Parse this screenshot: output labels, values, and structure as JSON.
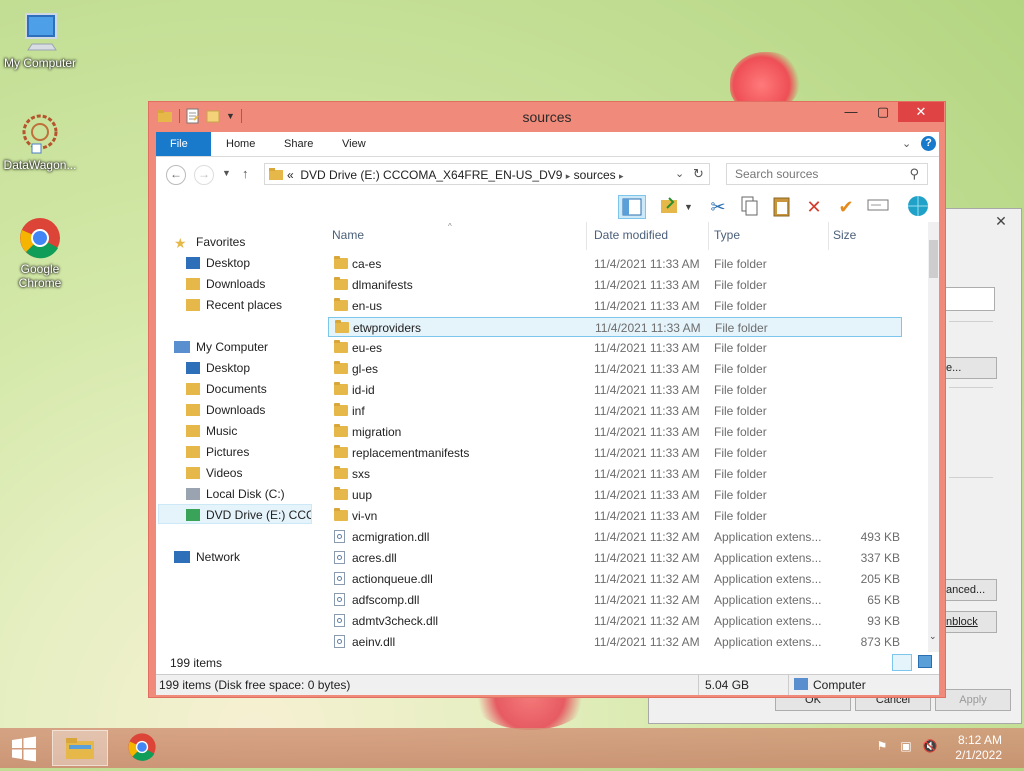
{
  "desktop": {
    "icons": [
      {
        "label": "My Computer"
      },
      {
        "label": "DataWagon..."
      },
      {
        "label": "Google Chrome"
      }
    ]
  },
  "dialog": {
    "btn_change": "e...",
    "btn_advanced": "anced...",
    "btn_unblock": "nblock",
    "btn_ok": "OK",
    "btn_cancel": "Cancel",
    "btn_apply": "Apply"
  },
  "explorer": {
    "title": "sources",
    "tabs": [
      "File",
      "Home",
      "Share",
      "View"
    ],
    "address": {
      "prefix": "«",
      "segments": [
        "DVD Drive (E:) CCCOMA_X64FRE_EN-US_DV9",
        "sources"
      ]
    },
    "search_placeholder": "Search sources",
    "nav": {
      "favorites": "Favorites",
      "fav_items": [
        "Desktop",
        "Downloads",
        "Recent places"
      ],
      "computer": "My Computer",
      "comp_items": [
        "Desktop",
        "Documents",
        "Downloads",
        "Music",
        "Pictures",
        "Videos",
        "Local Disk (C:)",
        "DVD Drive (E:) CCCC"
      ],
      "network": "Network"
    },
    "columns": {
      "name": "Name",
      "date": "Date modified",
      "type": "Type",
      "size": "Size"
    },
    "files": [
      {
        "name": "ca-es",
        "date": "11/4/2021 11:33 AM",
        "type": "File folder",
        "size": "",
        "kind": "folder"
      },
      {
        "name": "dlmanifests",
        "date": "11/4/2021 11:33 AM",
        "type": "File folder",
        "size": "",
        "kind": "folder"
      },
      {
        "name": "en-us",
        "date": "11/4/2021 11:33 AM",
        "type": "File folder",
        "size": "",
        "kind": "folder"
      },
      {
        "name": "etwproviders",
        "date": "11/4/2021 11:33 AM",
        "type": "File folder",
        "size": "",
        "kind": "folder",
        "selected": true
      },
      {
        "name": "eu-es",
        "date": "11/4/2021 11:33 AM",
        "type": "File folder",
        "size": "",
        "kind": "folder"
      },
      {
        "name": "gl-es",
        "date": "11/4/2021 11:33 AM",
        "type": "File folder",
        "size": "",
        "kind": "folder"
      },
      {
        "name": "id-id",
        "date": "11/4/2021 11:33 AM",
        "type": "File folder",
        "size": "",
        "kind": "folder"
      },
      {
        "name": "inf",
        "date": "11/4/2021 11:33 AM",
        "type": "File folder",
        "size": "",
        "kind": "folder"
      },
      {
        "name": "migration",
        "date": "11/4/2021 11:33 AM",
        "type": "File folder",
        "size": "",
        "kind": "folder"
      },
      {
        "name": "replacementmanifests",
        "date": "11/4/2021 11:33 AM",
        "type": "File folder",
        "size": "",
        "kind": "folder"
      },
      {
        "name": "sxs",
        "date": "11/4/2021 11:33 AM",
        "type": "File folder",
        "size": "",
        "kind": "folder"
      },
      {
        "name": "uup",
        "date": "11/4/2021 11:33 AM",
        "type": "File folder",
        "size": "",
        "kind": "folder"
      },
      {
        "name": "vi-vn",
        "date": "11/4/2021 11:33 AM",
        "type": "File folder",
        "size": "",
        "kind": "folder"
      },
      {
        "name": "acmigration.dll",
        "date": "11/4/2021 11:32 AM",
        "type": "Application extens...",
        "size": "493 KB",
        "kind": "dll"
      },
      {
        "name": "acres.dll",
        "date": "11/4/2021 11:32 AM",
        "type": "Application extens...",
        "size": "337 KB",
        "kind": "dll"
      },
      {
        "name": "actionqueue.dll",
        "date": "11/4/2021 11:32 AM",
        "type": "Application extens...",
        "size": "205 KB",
        "kind": "dll"
      },
      {
        "name": "adfscomp.dll",
        "date": "11/4/2021 11:32 AM",
        "type": "Application extens...",
        "size": "65 KB",
        "kind": "dll"
      },
      {
        "name": "admtv3check.dll",
        "date": "11/4/2021 11:32 AM",
        "type": "Application extens...",
        "size": "93 KB",
        "kind": "dll"
      },
      {
        "name": "aeinv.dll",
        "date": "11/4/2021 11:32 AM",
        "type": "Application extens...",
        "size": "873 KB",
        "kind": "dll"
      }
    ],
    "item_count": "199 items",
    "status_left": "199 items (Disk free space: 0 bytes)",
    "status_size": "5.04 GB",
    "status_location": "Computer"
  },
  "taskbar": {
    "time": "8:12 AM",
    "date": "2/1/2022"
  },
  "colors": {
    "window_border": "#f08a7a",
    "ribbon_file_tab": "#1979ca",
    "selection": "#e5f3fb",
    "close_button": "#e04343"
  }
}
